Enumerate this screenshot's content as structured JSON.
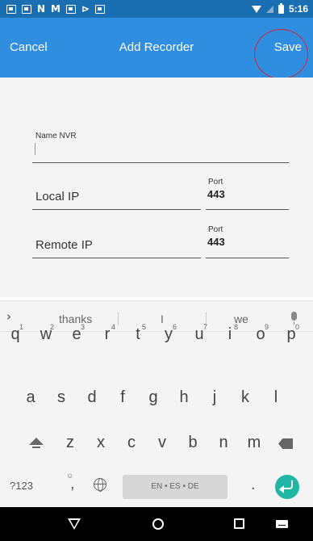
{
  "status_bar": {
    "time": "5:16",
    "left_icons": [
      "image-icon",
      "message-icon",
      "n-icon",
      "m-icon",
      "phone-icon",
      "flag-icon",
      "video-icon"
    ],
    "right_icons": [
      "wifi-icon",
      "signal-icon",
      "battery-icon"
    ]
  },
  "app_bar": {
    "cancel": "Cancel",
    "title": "Add Recorder",
    "save": "Save",
    "highlight_color": "#d8232a",
    "background": "#2f8ee0"
  },
  "form": {
    "name_label": "Name NVR",
    "name_value": "",
    "local_label": "Local IP",
    "local_port_label": "Port",
    "local_port_value": "443",
    "remote_label": "Remote IP",
    "remote_port_label": "Port",
    "remote_port_value": "443"
  },
  "keyboard": {
    "suggestions": [
      "thanks",
      "I",
      "we"
    ],
    "row1": [
      "q",
      "w",
      "e",
      "r",
      "t",
      "y",
      "u",
      "i",
      "o",
      "p"
    ],
    "row1_hints": [
      "1",
      "2",
      "3",
      "4",
      "5",
      "6",
      "7",
      "8",
      "9",
      "0"
    ],
    "row2": [
      "a",
      "s",
      "d",
      "f",
      "g",
      "h",
      "j",
      "k",
      "l"
    ],
    "row3": [
      "z",
      "x",
      "c",
      "v",
      "b",
      "n",
      "m"
    ],
    "symbols_key": "?123",
    "comma_key": ",",
    "comma_hint": "☺",
    "space_label": "EN • ES • DE",
    "period_key": ".",
    "enter_color": "#1fb6a4"
  },
  "nav_bar": {
    "buttons": [
      "back-icon",
      "home-icon",
      "recents-icon",
      "keyboard-switch-icon"
    ]
  }
}
